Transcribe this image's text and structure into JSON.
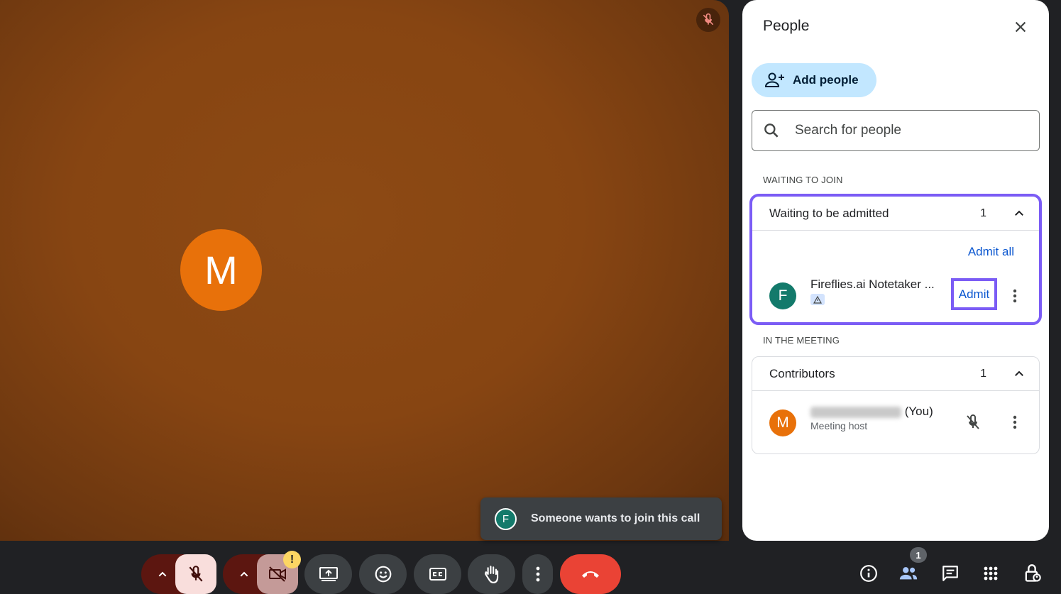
{
  "tile": {
    "avatar_letter": "M"
  },
  "toast": {
    "avatar_letter": "F",
    "message": "Someone wants to join this call"
  },
  "panel": {
    "title": "People",
    "add_people_label": "Add people",
    "search_placeholder": "Search for people",
    "waiting_section_label": "WAITING TO JOIN",
    "in_meeting_section_label": "IN THE MEETING",
    "waiting_group": {
      "title": "Waiting to be admitted",
      "count": "1",
      "admit_all_label": "Admit all",
      "person": {
        "avatar_letter": "F",
        "name": "Fireflies.ai Notetaker ...",
        "admit_label": "Admit"
      }
    },
    "contributors_group": {
      "title": "Contributors",
      "count": "1",
      "person": {
        "avatar_letter": "M",
        "name_suffix": "(You)",
        "role": "Meeting host"
      }
    }
  },
  "bottom_bar": {
    "camera_warning": "!",
    "people_count": "1"
  },
  "colors": {
    "accent_blue": "#0b57d0",
    "highlight_purple": "#7b5cf5",
    "end_call_red": "#ea4335",
    "avatar_orange": "#e8710a",
    "avatar_teal": "#137a6b"
  }
}
